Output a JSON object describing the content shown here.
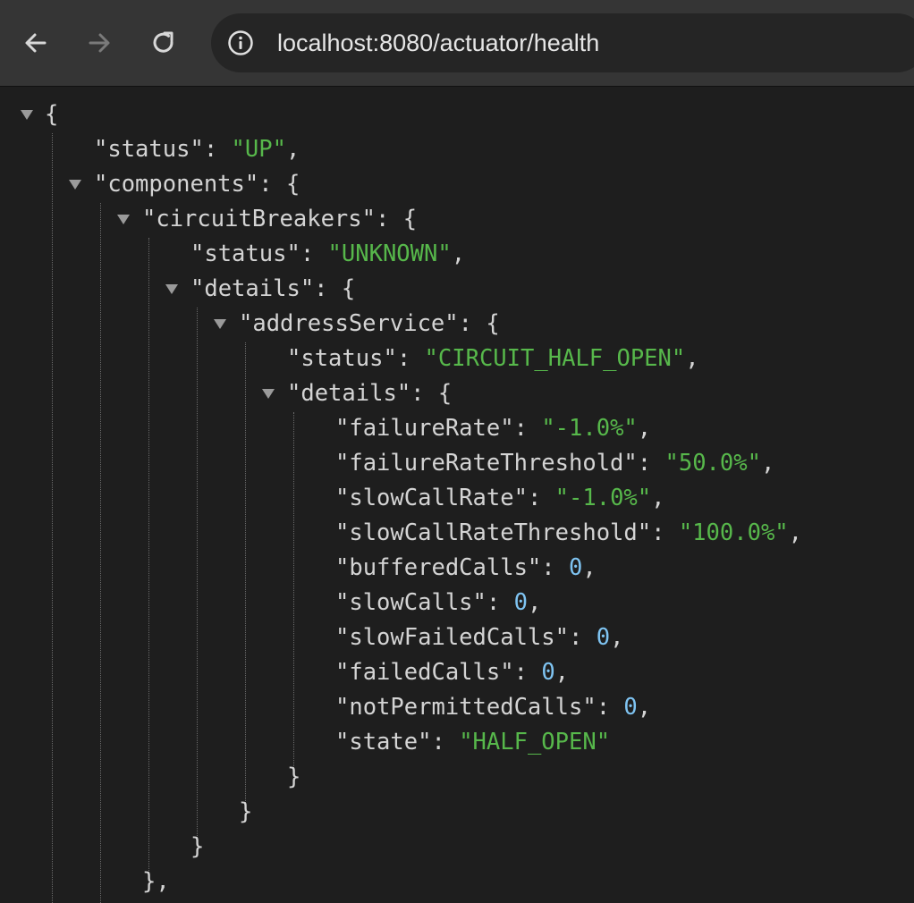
{
  "browser": {
    "url": "localhost:8080/actuator/health"
  },
  "json_view": {
    "root_open": "{",
    "status_key": "\"status\"",
    "status_value": "\"UP\"",
    "components_key": "\"components\"",
    "circuitBreakers_key": "\"circuitBreakers\"",
    "cb_status_key": "\"status\"",
    "cb_status_value": "\"UNKNOWN\"",
    "cb_details_key": "\"details\"",
    "addressService_key": "\"addressService\"",
    "as_status_key": "\"status\"",
    "as_status_value": "\"CIRCUIT_HALF_OPEN\"",
    "as_details_key": "\"details\"",
    "fields": [
      {
        "key": "\"failureRate\"",
        "value": "\"-1.0%\"",
        "type": "string",
        "comma": ","
      },
      {
        "key": "\"failureRateThreshold\"",
        "value": "\"50.0%\"",
        "type": "string",
        "comma": ","
      },
      {
        "key": "\"slowCallRate\"",
        "value": "\"-1.0%\"",
        "type": "string",
        "comma": ","
      },
      {
        "key": "\"slowCallRateThreshold\"",
        "value": "\"100.0%\"",
        "type": "string",
        "comma": ","
      },
      {
        "key": "\"bufferedCalls\"",
        "value": "0",
        "type": "number",
        "comma": ","
      },
      {
        "key": "\"slowCalls\"",
        "value": "0",
        "type": "number",
        "comma": ","
      },
      {
        "key": "\"slowFailedCalls\"",
        "value": "0",
        "type": "number",
        "comma": ","
      },
      {
        "key": "\"failedCalls\"",
        "value": "0",
        "type": "number",
        "comma": ","
      },
      {
        "key": "\"notPermittedCalls\"",
        "value": "0",
        "type": "number",
        "comma": ","
      },
      {
        "key": "\"state\"",
        "value": "\"HALF_OPEN\"",
        "type": "string",
        "comma": ""
      }
    ],
    "close_details": "}",
    "close_addressService": "}",
    "close_cb_details": "}",
    "close_circuitBreakers": "},"
  },
  "colors": {
    "string": "#57b84b",
    "number": "#7fc4f2",
    "key": "#d4d4d4"
  },
  "icons": [
    "back-arrow-icon",
    "forward-arrow-icon",
    "reload-icon",
    "info-icon",
    "disclosure-triangle-icon"
  ]
}
